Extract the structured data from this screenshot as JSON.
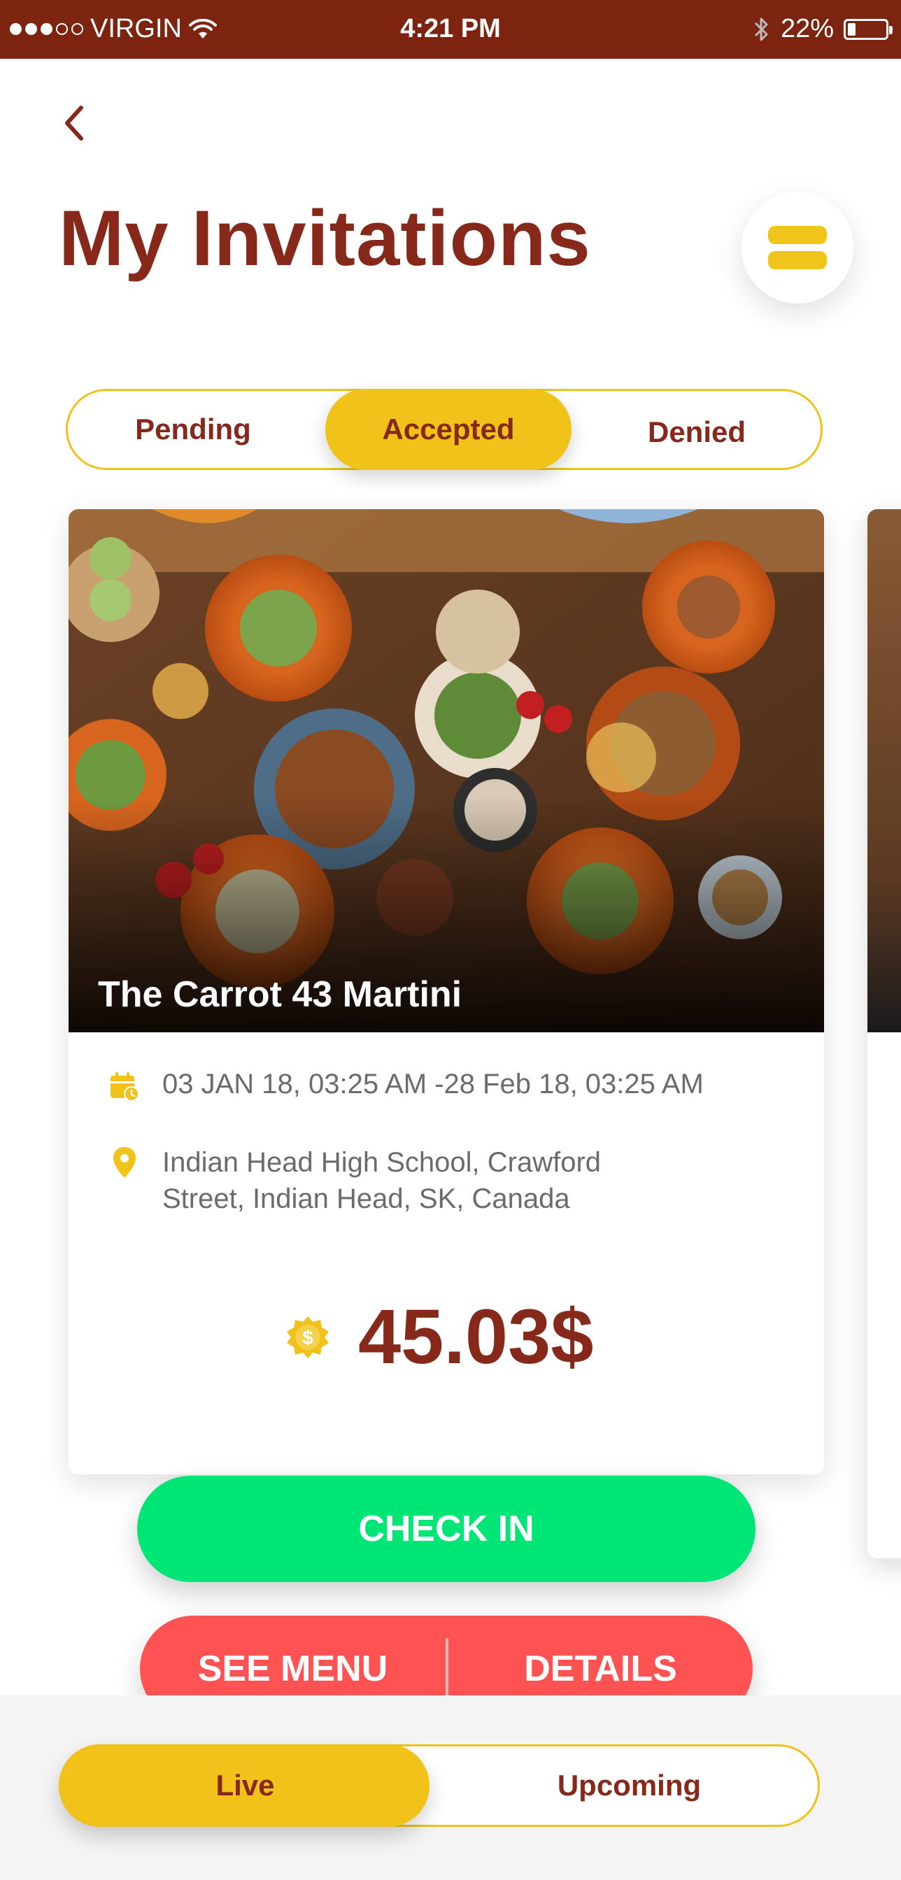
{
  "status_bar": {
    "carrier": "VIRGIN",
    "time": "4:21 PM",
    "battery": "22%",
    "battery_level": 0.22,
    "signal_bars_filled": 3,
    "signal_bars_total": 5
  },
  "header": {
    "title": "My Invitations"
  },
  "tabs": {
    "items": [
      "Pending",
      "Accepted",
      "Denied"
    ],
    "selected": "Accepted"
  },
  "card": {
    "name": "The Carrot 43 Martini",
    "date_range": "03 JAN 18, 03:25 AM -28 Feb 18, 03:25 AM",
    "address_line1": "Indian Head High School, Crawford",
    "address_line2": "Street, Indian Head, SK, Canada",
    "price": "45.03$"
  },
  "actions": {
    "check_in": "CHECK IN",
    "see_menu": "SEE MENU",
    "details": "DETAILS"
  },
  "bottom_tabs": {
    "items": [
      "Live",
      "Upcoming"
    ],
    "selected": "Live"
  },
  "colors": {
    "brand": "#86281a",
    "accent": "#f0c21a",
    "check_in": "#00e676",
    "secondary_action": "#ff5252"
  },
  "icons": [
    "back-chevron-icon",
    "menu-icon",
    "calendar-clock-icon",
    "location-pin-icon",
    "coin-dollar-icon",
    "wifi-icon",
    "bluetooth-icon",
    "battery-icon"
  ]
}
